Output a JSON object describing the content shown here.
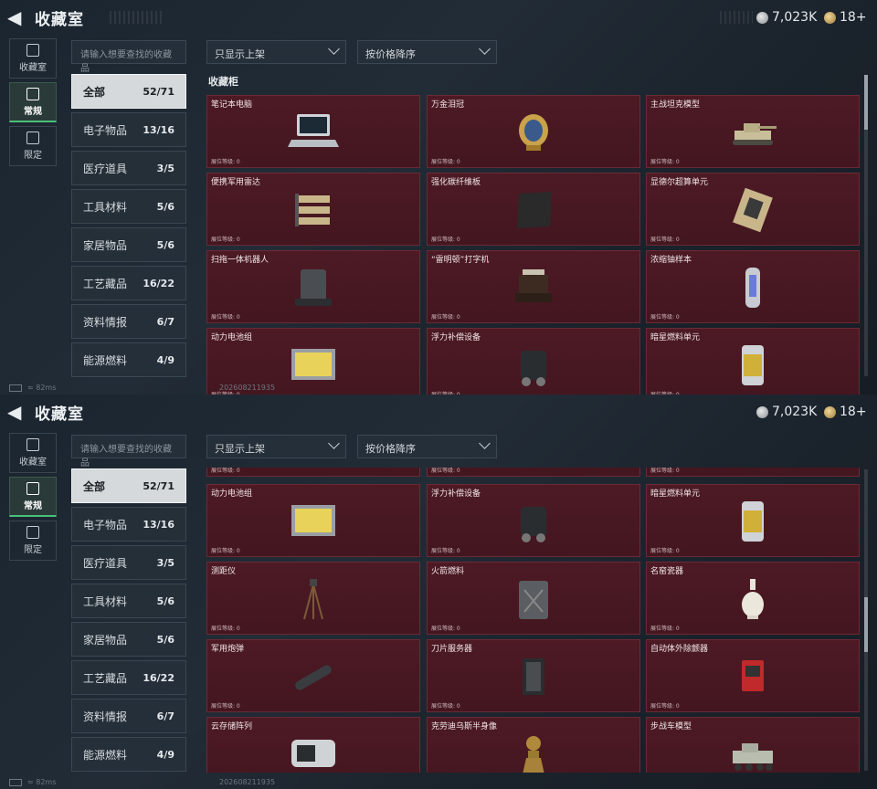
{
  "header": {
    "title": "收藏室",
    "currency_silver": "7,023K",
    "currency_gold": "18+"
  },
  "sidetabs": [
    {
      "label": "收藏室",
      "icon": "bust-icon"
    },
    {
      "label": "常规",
      "icon": "picture-icon"
    },
    {
      "label": "限定",
      "icon": "picture-icon"
    }
  ],
  "search": {
    "placeholder": "请输入想要查找的收藏品"
  },
  "filters": {
    "shelf": "只显示上架",
    "sort": "按价格降序"
  },
  "categories": [
    {
      "label": "全部",
      "count": "52/71"
    },
    {
      "label": "电子物品",
      "count": "13/16"
    },
    {
      "label": "医疗道具",
      "count": "3/5"
    },
    {
      "label": "工具材料",
      "count": "5/6"
    },
    {
      "label": "家居物品",
      "count": "5/6"
    },
    {
      "label": "工艺藏品",
      "count": "16/22"
    },
    {
      "label": "资料情报",
      "count": "6/7"
    },
    {
      "label": "能源燃料",
      "count": "4/9"
    }
  ],
  "section_title": "收藏柜",
  "level_label": "展位等级: 0",
  "items_top": [
    {
      "name": "笔记本电脑",
      "icon": "laptop-icon"
    },
    {
      "name": "万金泪冠",
      "icon": "jeweled-egg-icon"
    },
    {
      "name": "主战坦克模型",
      "icon": "tank-model-icon"
    },
    {
      "name": "便携军用雷达",
      "icon": "radar-icon"
    },
    {
      "name": "强化碳纤维板",
      "icon": "carbon-plate-icon"
    },
    {
      "name": "显德尔超算单元",
      "icon": "chip-icon"
    },
    {
      "name": "扫拖一体机器人",
      "icon": "robot-vacuum-icon"
    },
    {
      "name": "“雷明顿”打字机",
      "icon": "typewriter-icon"
    },
    {
      "name": "浓缩铀样本",
      "icon": "uranium-canister-icon"
    },
    {
      "name": "动力电池组",
      "icon": "battery-pack-icon"
    },
    {
      "name": "浮力补偿设备",
      "icon": "buoyancy-device-icon"
    },
    {
      "name": "暗星燃料单元",
      "icon": "fuel-cell-icon"
    }
  ],
  "items_bottom": [
    {
      "name": "动力电池组",
      "icon": "battery-pack-icon"
    },
    {
      "name": "浮力补偿设备",
      "icon": "buoyancy-device-icon"
    },
    {
      "name": "暗星燃料单元",
      "icon": "fuel-cell-icon"
    },
    {
      "name": "测距仪",
      "icon": "rangefinder-icon"
    },
    {
      "name": "火箭燃料",
      "icon": "jerrycan-icon"
    },
    {
      "name": "名窑瓷器",
      "icon": "vase-icon"
    },
    {
      "name": "军用炮弹",
      "icon": "shell-icon"
    },
    {
      "name": "刀片服务器",
      "icon": "server-icon"
    },
    {
      "name": "自动体外除颤器",
      "icon": "defibrillator-icon"
    },
    {
      "name": "云存储阵列",
      "icon": "storage-array-icon"
    },
    {
      "name": "克劳迪乌斯半身像",
      "icon": "bust-statue-icon"
    },
    {
      "name": "步战车模型",
      "icon": "ifv-model-icon"
    }
  ],
  "status": {
    "ping": "82ms",
    "build_id": "2026082119​35"
  }
}
